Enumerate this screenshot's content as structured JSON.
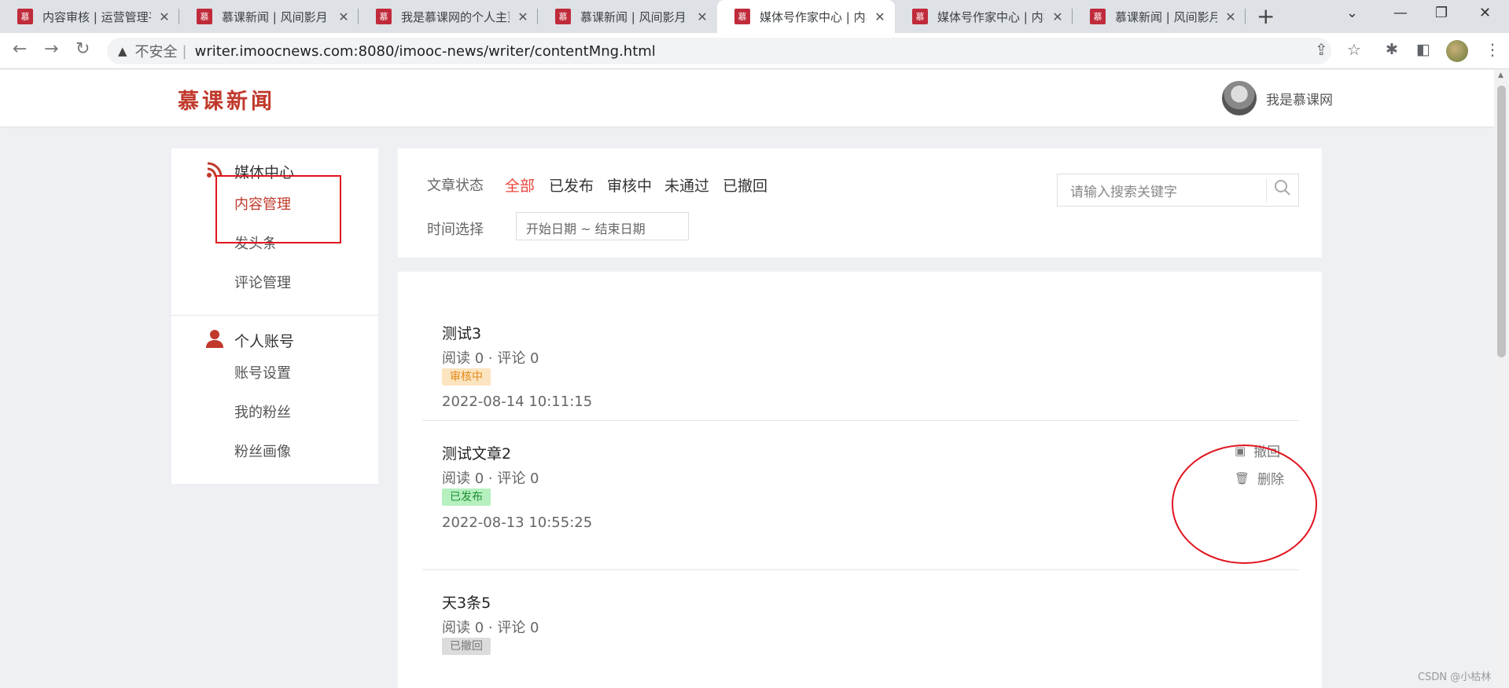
{
  "browser": {
    "tabs": [
      {
        "fav": "慕",
        "title": "内容审核 | 运营管理平"
      },
      {
        "fav": "慕",
        "title": "慕课新闻 | 风间影月"
      },
      {
        "fav": "慕",
        "title": "我是慕课网的个人主页"
      },
      {
        "fav": "慕",
        "title": "慕课新闻 | 风间影月"
      },
      {
        "fav": "慕",
        "title": "媒体号作家中心 | 内容"
      },
      {
        "fav": "慕",
        "title": "媒体号作家中心 | 内容"
      },
      {
        "fav": "慕",
        "title": "慕课新闻 | 风间影月"
      }
    ],
    "new_tab": "+",
    "not_secure": "不安全",
    "url": "writer.imoocnews.com:8080/imooc-news/writer/contentMng.html"
  },
  "header": {
    "logo": "慕课新闻",
    "username": "我是慕课网"
  },
  "sidebar": {
    "media_center": "媒体中心",
    "media_items": [
      "内容管理",
      "发头条",
      "评论管理"
    ],
    "account": "个人账号",
    "account_items": [
      "账号设置",
      "我的粉丝",
      "粉丝画像"
    ]
  },
  "filter": {
    "status_label": "文章状态",
    "status_options": [
      "全部",
      "已发布",
      "审核中",
      "未通过",
      "已撤回"
    ],
    "time_label": "时间选择",
    "date_placeholder": "开始日期 ~ 结束日期",
    "search_placeholder": "请输入搜索关键字"
  },
  "articles": [
    {
      "title": "测试3",
      "stats": "阅读 0 · 评论 0",
      "status": "审核中",
      "date": "2022-08-14 10:11:15"
    },
    {
      "title": "测试文章2",
      "stats": "阅读 0 · 评论 0",
      "status": "已发布",
      "date": "2022-08-13 10:55:25",
      "actions": [
        "撤回",
        "删除"
      ]
    },
    {
      "title": "天3条5",
      "stats": "阅读 0 · 评论 0",
      "status": "已撤回"
    }
  ],
  "watermark": "CSDN @小枯林"
}
